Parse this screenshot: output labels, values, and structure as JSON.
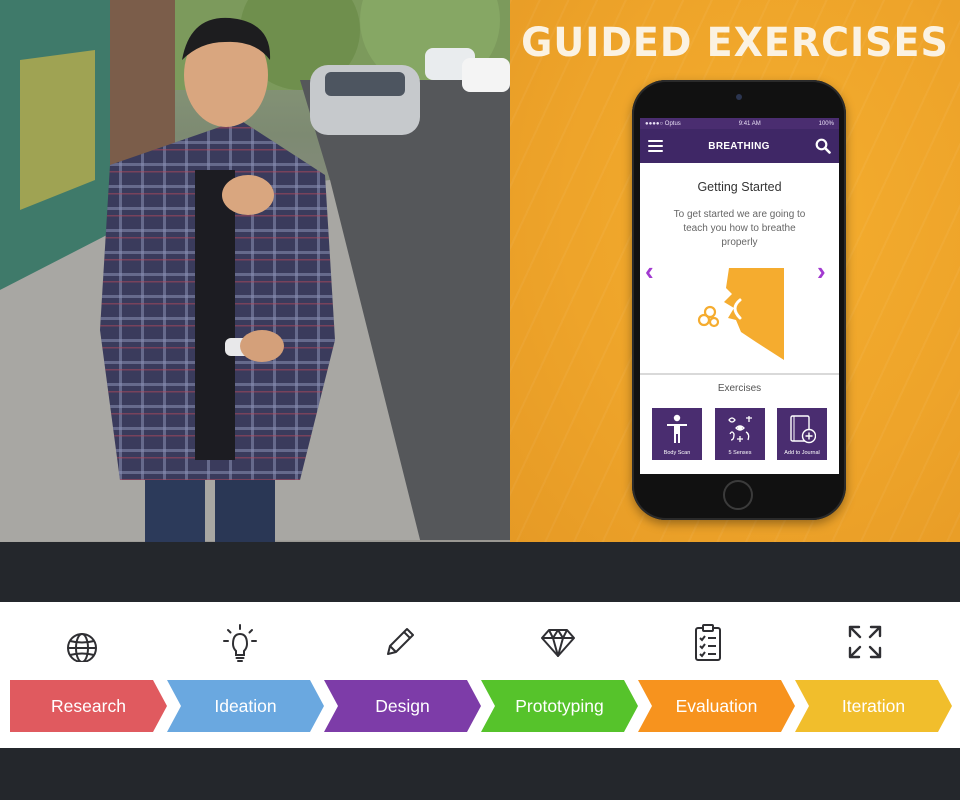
{
  "promo": {
    "title": "GUIDED EXERCISES"
  },
  "phone": {
    "status_carrier": "●●●●○ Optus",
    "status_time": "9:41 AM",
    "status_battery": "100%",
    "nav_title": "BREATHING",
    "screen_title": "Getting Started",
    "screen_description": "To get started we are going to teach you how to breathe properly",
    "exercises_label": "Exercises",
    "exercises": [
      {
        "label": "Body Scan",
        "icon": "body-scan-icon"
      },
      {
        "label": "5 Senses",
        "icon": "senses-icon"
      },
      {
        "label": "Add to Journal",
        "icon": "journal-add-icon"
      }
    ]
  },
  "process": {
    "steps": [
      {
        "label": "Research",
        "icon": "globe-icon",
        "color": "#e05a5f"
      },
      {
        "label": "Ideation",
        "icon": "lightbulb-icon",
        "color": "#6aa8e0"
      },
      {
        "label": "Design",
        "icon": "pencil-icon",
        "color": "#7d3ca8"
      },
      {
        "label": "Prototyping",
        "icon": "diamond-icon",
        "color": "#56c32b"
      },
      {
        "label": "Evaluation",
        "icon": "clipboard-icon",
        "color": "#f7931e"
      },
      {
        "label": "Iteration",
        "icon": "iterate-arrows-icon",
        "color": "#f1be2c"
      }
    ]
  },
  "colors": {
    "background": "#24272c",
    "promo": "#eea42a",
    "app_purple": "#3f2766",
    "arrow_accent": "#a23ad0"
  }
}
